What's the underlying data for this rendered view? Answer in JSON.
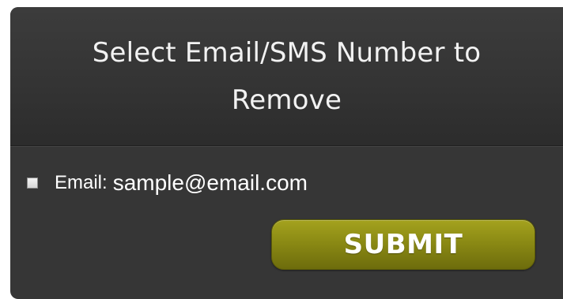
{
  "dialog": {
    "title": "Select Email/SMS Number to Remove",
    "options": [
      {
        "label": "Email:",
        "value": "sample@email.com",
        "checked": false
      }
    ],
    "submit_label": "SUBMIT"
  },
  "colors": {
    "panel_background": "#363636",
    "title_text": "#f2f2f2",
    "submit_button": "#8b8a14",
    "page_background": "#ffffff"
  }
}
